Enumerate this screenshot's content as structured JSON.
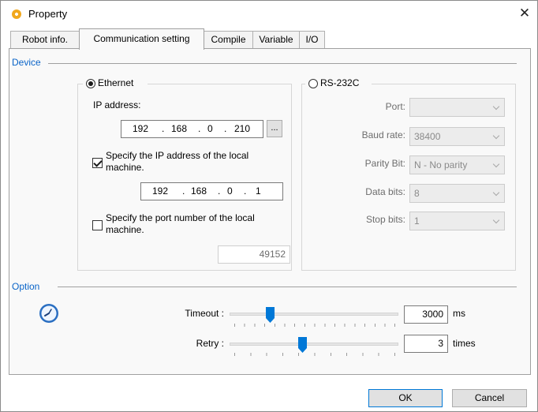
{
  "window": {
    "title": "Property"
  },
  "tabs": [
    {
      "label": "Robot info."
    },
    {
      "label": "Communication setting"
    },
    {
      "label": "Compile"
    },
    {
      "label": "Variable"
    },
    {
      "label": "I/O"
    }
  ],
  "device": {
    "section_label": "Device",
    "ethernet": {
      "label": "Ethernet",
      "selected": true,
      "ip_label": "IP address:",
      "ip_octets": [
        "192",
        "168",
        "0",
        "210"
      ],
      "browse_label": "...",
      "local_ip_check_label": "Specify the IP address of the local machine.",
      "local_ip_checked": true,
      "local_ip_octets": [
        "192",
        "168",
        "0",
        "1"
      ],
      "local_port_check_label": "Specify the port number of the local machine.",
      "local_port_checked": false,
      "local_port_value": "49152"
    },
    "rs232c": {
      "label": "RS-232C",
      "selected": false,
      "port_label": "Port:",
      "port_value": "",
      "baud_label": "Baud rate:",
      "baud_value": "38400",
      "parity_label": "Parity Bit:",
      "parity_value": "N - No parity",
      "databits_label": "Data bits:",
      "databits_value": "8",
      "stopbits_label": "Stop bits:",
      "stopbits_value": "1"
    }
  },
  "option": {
    "section_label": "Option",
    "icon": "clock-icon",
    "timeout_label": "Timeout :",
    "timeout_value": "3000",
    "timeout_unit": "ms",
    "retry_label": "Retry :",
    "retry_value": "3",
    "retry_unit": "times"
  },
  "buttons": {
    "ok": "OK",
    "cancel": "Cancel"
  },
  "colors": {
    "accent": "#0078d7",
    "section_label": "#0a64c8",
    "title_icon": "#f1a81d"
  }
}
